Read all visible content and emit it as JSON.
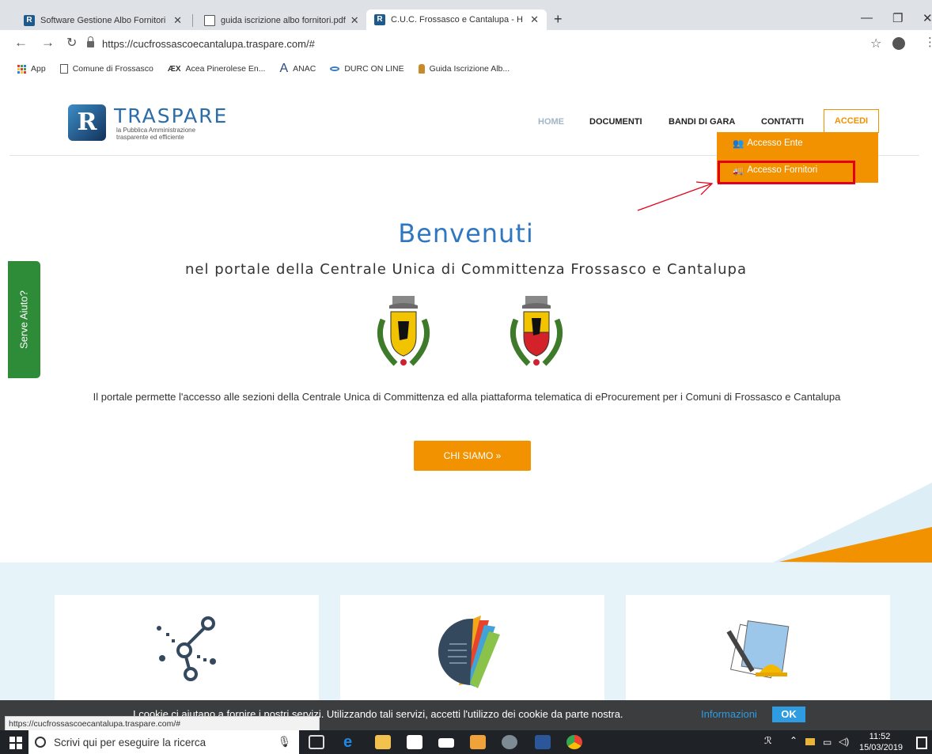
{
  "browser": {
    "tabs": [
      {
        "title": "Software Gestione Albo Fornitori",
        "close": "✕",
        "icon": "traspare-favicon"
      },
      {
        "title": "guida iscrizione albo fornitori.pdf",
        "close": "✕",
        "icon": "document-icon"
      },
      {
        "title": "C.U.C. Frossasco e Cantalupa - H",
        "close": "✕",
        "icon": "traspare-favicon"
      }
    ],
    "new_tab": "+",
    "window_controls": {
      "minimize": "—",
      "restore": "❐",
      "close": "✕"
    },
    "url": "https://cucfrossascoecantalupa.traspare.com/#",
    "bookmarks": [
      {
        "label": "App",
        "icon": "apps-grid-icon"
      },
      {
        "label": "Comune di Frossasco",
        "icon": "document-icon"
      },
      {
        "label": "Acea Pinerolese En...",
        "icon": "acea-icon"
      },
      {
        "label": "ANAC",
        "icon": "anac-icon"
      },
      {
        "label": "DURC ON LINE",
        "icon": "durc-icon"
      },
      {
        "label": "Guida Iscrizione Alb...",
        "icon": "guide-icon"
      }
    ],
    "status_url": "https://cucfrossascoecantalupa.traspare.com/#"
  },
  "site": {
    "logo": {
      "mark": "R",
      "title": "TRASPARE",
      "tagline_1": "la Pubblica Amministrazione",
      "tagline_2": "trasparente ed efficiente"
    },
    "nav": {
      "home": "HOME",
      "documenti": "DOCUMENTI",
      "bandi": "BANDI DI GARA",
      "contatti": "CONTATTI",
      "accedi": "ACCEDI"
    },
    "dropdown": {
      "ente": "Accesso Ente",
      "fornitori": "Accesso Fornitori"
    },
    "hero": {
      "welcome": "Benvenuti",
      "subtitle": "nel portale della Centrale Unica di Committenza Frossasco e Cantalupa",
      "description": "Il portale permette l'accesso alle sezioni della Centrale Unica di Committenza ed alla piattaforma telematica di eProcurement per i Comuni di Frossasco e Cantalupa",
      "cta": "CHI SIAMO »"
    },
    "help_tab": "Serve Aiuto?",
    "cookie": {
      "text": "I cookie ci aiutano a fornire i nostri servizi. Utilizzando tali servizi, accetti l'utilizzo dei cookie da parte nostra.",
      "info": "Informazioni",
      "ok": "OK"
    }
  },
  "taskbar": {
    "search_placeholder": "Scrivi qui per eseguire la ricerca",
    "time": "11:52",
    "date": "15/03/2019"
  },
  "colors": {
    "accent_orange": "#f29200",
    "brand_blue": "#2f78c1",
    "help_green": "#2e8b38",
    "highlight_red": "#e4001b"
  }
}
